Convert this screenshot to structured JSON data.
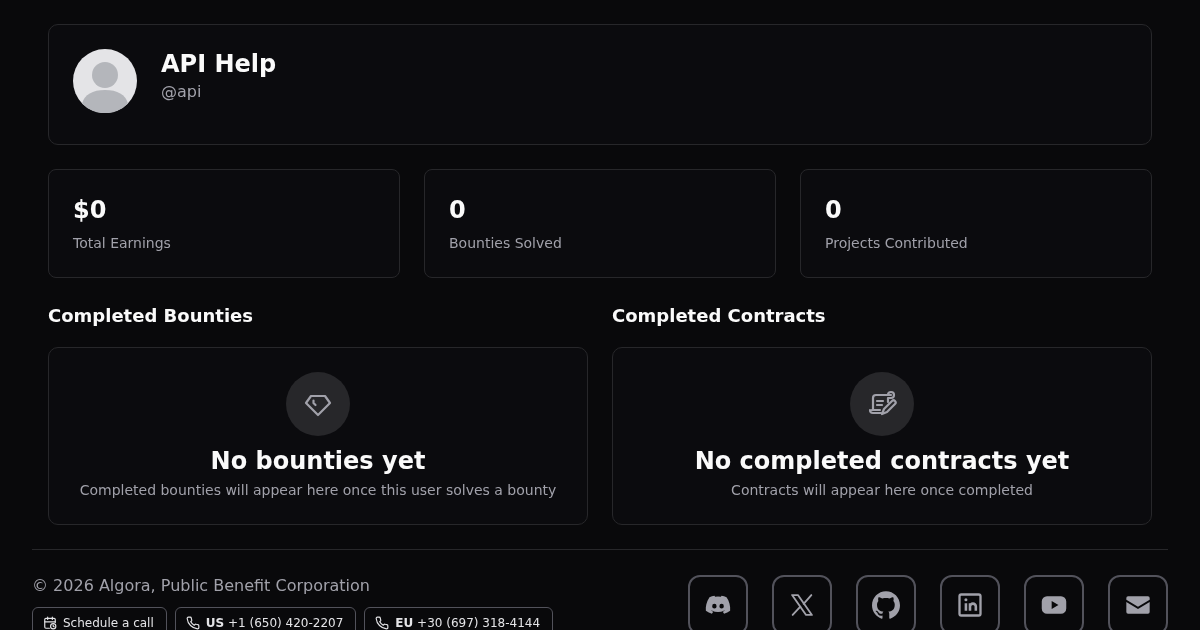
{
  "profile": {
    "name": "API Help",
    "handle": "@api"
  },
  "stats": [
    {
      "value": "$0",
      "label": "Total Earnings"
    },
    {
      "value": "0",
      "label": "Bounties Solved"
    },
    {
      "value": "0",
      "label": "Projects Contributed"
    }
  ],
  "sections": [
    {
      "kind": "bounties",
      "title": "Completed Bounties",
      "empty_title": "No bounties yet",
      "empty_text": "Completed bounties will appear here once this user solves a bounty"
    },
    {
      "kind": "contracts",
      "title": "Completed Contracts",
      "empty_title": "No completed contracts yet",
      "empty_text": "Contracts will appear here once completed"
    }
  ],
  "footer": {
    "copyright": "© 2026 Algora, Public Benefit Corporation",
    "contact_buttons": [
      {
        "kind": "schedule",
        "label": "Schedule a call"
      },
      {
        "kind": "phone",
        "label": "**US** +1 (650) 420-2207"
      },
      {
        "kind": "phone",
        "label": "**EU** +30 (697) 318-4144"
      }
    ],
    "social_links": [
      {
        "kind": "discord"
      },
      {
        "kind": "x"
      },
      {
        "kind": "github"
      },
      {
        "kind": "linkedin"
      },
      {
        "kind": "youtube"
      },
      {
        "kind": "mail"
      }
    ]
  }
}
